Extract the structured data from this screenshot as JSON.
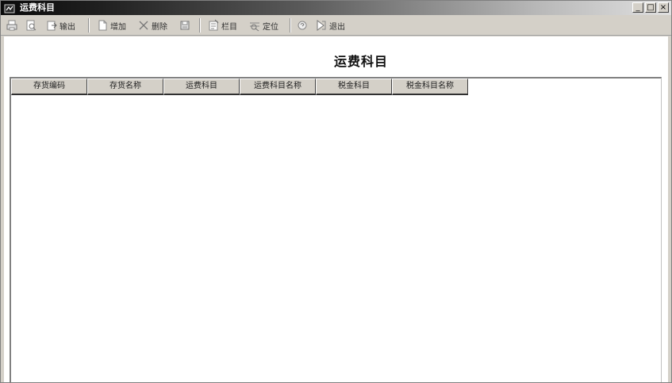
{
  "window": {
    "title": "运费科目",
    "controls": {
      "minimize": "_",
      "maximize": "□",
      "close": "×"
    }
  },
  "toolbar": {
    "output_label": "输出",
    "add_label": "增加",
    "delete_label": "删除",
    "column_label": "栏目",
    "locate_label": "定位",
    "exit_label": "退出"
  },
  "page": {
    "title": "运费科目"
  },
  "table": {
    "columns": [
      "存货编码",
      "存货名称",
      "运费科目",
      "运费科目名称",
      "税金科目",
      "税金科目名称"
    ],
    "rows": []
  }
}
